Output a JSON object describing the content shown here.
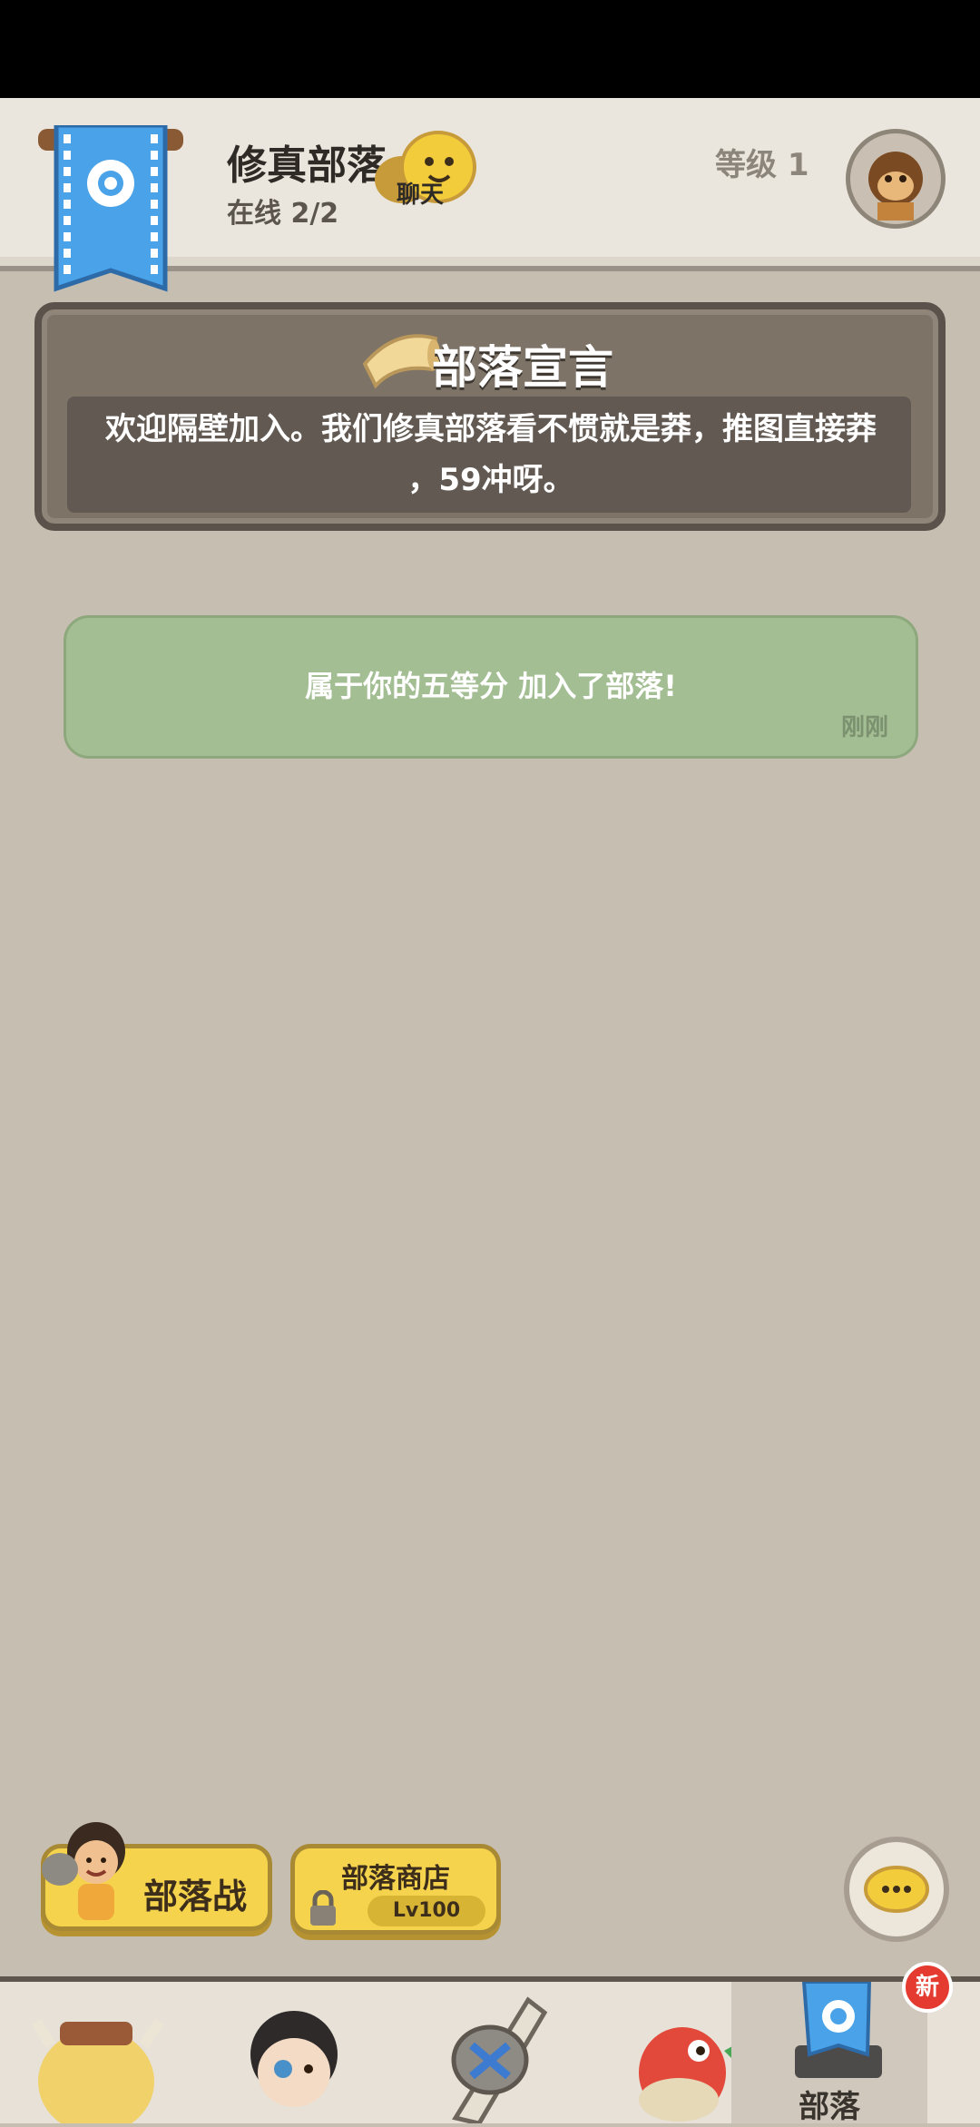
{
  "header": {
    "tribe_name": "修真部落",
    "online": "在线 2/2",
    "chat_label": "聊天",
    "level": "等级 1"
  },
  "declaration": {
    "title": "部落宣言",
    "line1": "欢迎隔壁加入。我们修真部落看不惯就是莽，推图直接莽",
    "line2": "，59冲呀。"
  },
  "event": {
    "text": "属于你的五等分 加入了部落!",
    "time": "刚刚"
  },
  "actions": {
    "war_label": "部落战",
    "shop_label": "部落商店",
    "shop_level": "Lv100"
  },
  "nav": {
    "active_label": "部落",
    "new_badge": "新"
  },
  "colors": {
    "background": "#c6beb1",
    "accent_yellow": "#f5d34c",
    "event_green": "#a4be94",
    "badge_red": "#e53a2f",
    "banner_blue": "#4aa3e8"
  },
  "icons": {
    "banner": "tribe-banner-icon",
    "chat": "chat-bubble-icon",
    "avatar": "monkey-avatar-icon",
    "horn": "horn-icon",
    "lock": "lock-icon"
  }
}
